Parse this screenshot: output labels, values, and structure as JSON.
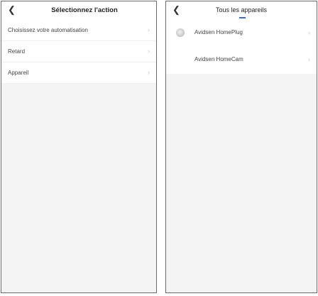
{
  "left_screen": {
    "back_icon": "chevron-left-icon",
    "title": "Sélectionnez l'action",
    "items": [
      {
        "label": "Choisissez votre automatisation",
        "chevron": "›"
      },
      {
        "label": "Retard",
        "chevron": "›"
      },
      {
        "label": "Appareil",
        "chevron": "›"
      }
    ]
  },
  "right_screen": {
    "back_icon": "chevron-left-icon",
    "title": "Tous les appareils",
    "accent_color": "#2f6fd8",
    "devices": [
      {
        "label": "Avidsen HomePlug",
        "icon": "device-plug-icon",
        "chevron": "›"
      },
      {
        "label": "Avidsen HomeCam",
        "chevron": "›"
      }
    ]
  }
}
